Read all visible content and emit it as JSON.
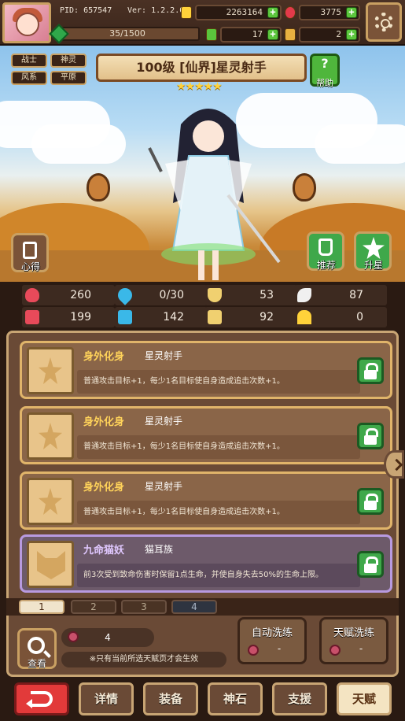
{
  "header": {
    "pid": "PID: 657547",
    "version": "Ver: 1.2.2.0",
    "gold": "2263164",
    "ruby": "3775",
    "xp": "35/1500",
    "clover": "17",
    "key": "2",
    "colors": {
      "gold": "#ffd23a",
      "ruby": "#e23a4a",
      "green": "#5bc53c"
    }
  },
  "hero": {
    "title": "100级  [仙界]星灵射手",
    "stars": "★★★★★",
    "tags": [
      "战士",
      "神灵",
      "风系",
      "平原"
    ],
    "help_label": "帮助",
    "help_icon": "?",
    "left_buttons": [
      {
        "label": "心得",
        "icon": "notebook-icon"
      }
    ],
    "right_buttons": [
      {
        "label": "推荐",
        "icon": "thumbs-up-icon"
      },
      {
        "label": "升星",
        "icon": "star-up-icon"
      }
    ]
  },
  "stats": [
    {
      "icon": "heart-icon",
      "value": "260",
      "color": "#e84a5a"
    },
    {
      "icon": "water-drop-icon",
      "value": "0/30",
      "color": "#3ab8e8"
    },
    {
      "icon": "shield-icon",
      "value": "53",
      "color": "#f0d070"
    },
    {
      "icon": "wing-icon",
      "value": "87",
      "color": "#f0f0f0"
    },
    {
      "icon": "fist-icon",
      "value": "199",
      "color": "#e84a5a"
    },
    {
      "icon": "book-icon",
      "value": "142",
      "color": "#3ab8e8"
    },
    {
      "icon": "scroll-icon",
      "value": "92",
      "color": "#f0d070"
    },
    {
      "icon": "horseshoe-icon",
      "value": "0",
      "color": "#ffd23a"
    }
  ],
  "talents": [
    {
      "name": "身外化身",
      "sub": "星灵射手",
      "desc": "普通攻击目标+1，每少1名目标使自身造成追击次数+1。"
    },
    {
      "name": "身外化身",
      "sub": "星灵射手",
      "desc": "普通攻击目标+1，每少1名目标使自身造成追击次数+1。"
    },
    {
      "name": "身外化身",
      "sub": "星灵射手",
      "desc": "普通攻击目标+1，每少1名目标使自身造成追击次数+1。"
    },
    {
      "name": "九命猫妖",
      "sub": "猫耳族",
      "desc": "前3次受到致命伤害时保留1点生命，并使自身失去50%的生命上限。"
    }
  ],
  "pages": [
    "1",
    "2",
    "3",
    "4"
  ],
  "footer": {
    "view_label": "查看",
    "cost": "4",
    "note": "※只有当前所选天赋页才会生效",
    "auto_wash": {
      "label": "自动洗练",
      "count": "-"
    },
    "talent_wash": {
      "label": "天赋洗练",
      "count": "-"
    }
  },
  "nav": [
    "详情",
    "装备",
    "神石",
    "支援",
    "天赋"
  ]
}
